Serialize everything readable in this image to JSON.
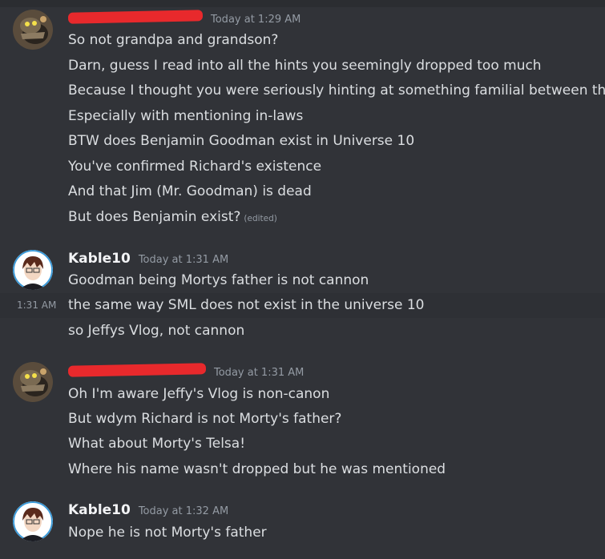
{
  "groups": [
    {
      "author": "",
      "redacted": true,
      "timestamp": "Today at 1:29 AM",
      "lines": [
        "So not grandpa and grandson?",
        "Darn, guess I read into all the hints you seemingly dropped too much",
        "Because I thought you were seriously hinting at something familial between them",
        "Especially with mentioning in-laws",
        "BTW does Benjamin Goodman exist in Universe 10",
        "You've confirmed Richard's existence",
        "And that Jim (Mr. Goodman) is dead",
        "But does Benjamin exist?"
      ],
      "edited_label": "(edited)"
    },
    {
      "author": "Kable10",
      "redacted": false,
      "timestamp": "Today at 1:31 AM",
      "lines": [
        "Goodman being Mortys father is not cannon",
        "the same way SML does not exist in the universe 10",
        "so Jeffys Vlog, not cannon"
      ],
      "hover_time": "1:31 AM"
    },
    {
      "author": "",
      "redacted": true,
      "timestamp": "Today at 1:31 AM",
      "lines": [
        "Oh I'm aware Jeffy's Vlog is non-canon",
        "But wdym Richard is not Morty's father?",
        "What about Morty's Telsa!",
        "Where his name wasn't dropped but he was mentioned"
      ]
    },
    {
      "author": "Kable10",
      "redacted": false,
      "timestamp": "Today at 1:32 AM",
      "lines": [
        "Nope he is not Morty's father"
      ]
    }
  ]
}
